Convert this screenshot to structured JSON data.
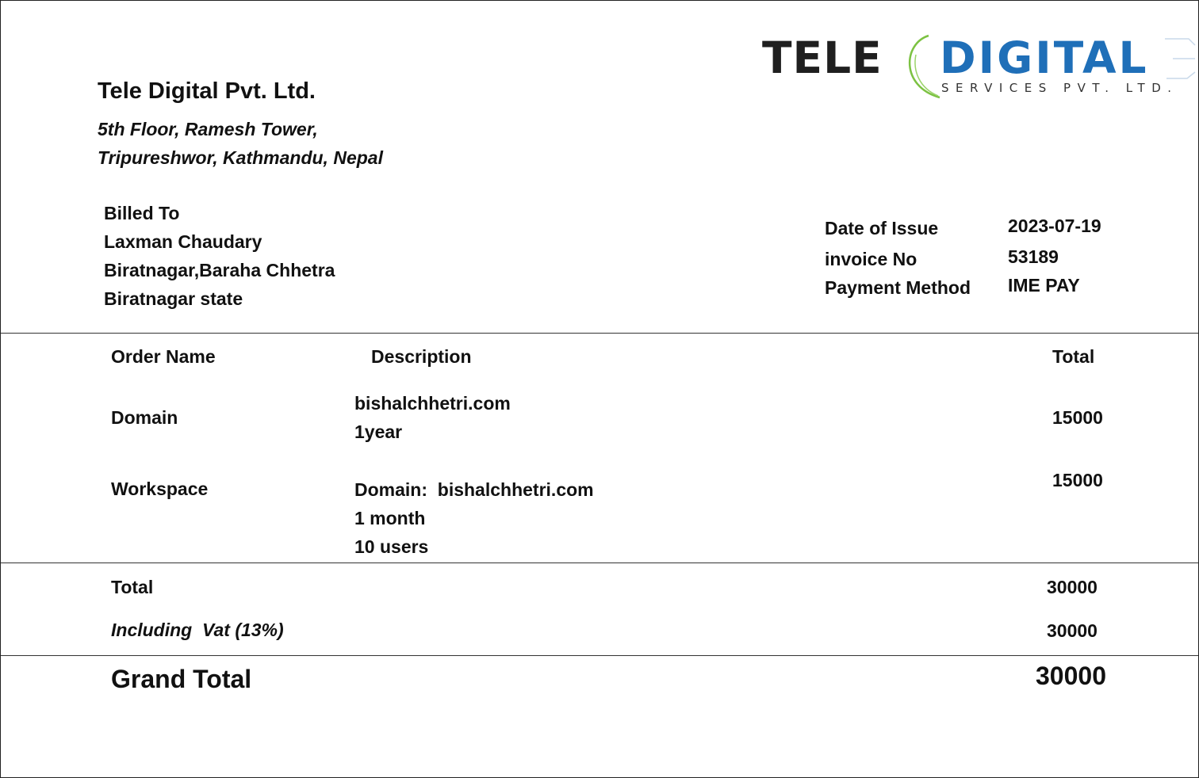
{
  "logo": {
    "word1": "TELE",
    "word2": "DIGITAL",
    "tagline": "SERVICES PVT. LTD."
  },
  "company": {
    "name": "Tele Digital Pvt. Ltd.",
    "address_line1": "5th Floor, Ramesh Tower,",
    "address_line2": "Tripureshwor, Kathmandu, Nepal"
  },
  "billed_to": {
    "heading": "Billed To",
    "name": "Laxman Chaudary",
    "line1": "Biratnagar,Baraha Chhetra",
    "line2": "Biratnagar state"
  },
  "meta": {
    "date_label": "Date of Issue",
    "date_value": "2023-07-19",
    "invoice_label": "invoice No",
    "invoice_value": "53189",
    "payment_label": "Payment Method",
    "payment_value": "IME PAY"
  },
  "table": {
    "headers": {
      "order_name": "Order Name",
      "description": "Description",
      "total": "Total"
    },
    "rows": [
      {
        "name": "Domain",
        "desc": [
          "bishalchhetri.com",
          "1year"
        ],
        "total": "15000"
      },
      {
        "name": "Workspace",
        "desc": [
          "Domain:  bishalchhetri.com",
          "1 month",
          "10 users"
        ],
        "total": "15000"
      }
    ]
  },
  "summary": {
    "total_label": "Total",
    "total_value": "30000",
    "vat_label": "Including  Vat (13%)",
    "vat_value": "30000",
    "grand_label": "Grand Total",
    "grand_value": "30000"
  },
  "colors": {
    "logo_dark": "#1f1f1f",
    "logo_blue": "#1f6fb8",
    "logo_green": "#7cc242"
  }
}
